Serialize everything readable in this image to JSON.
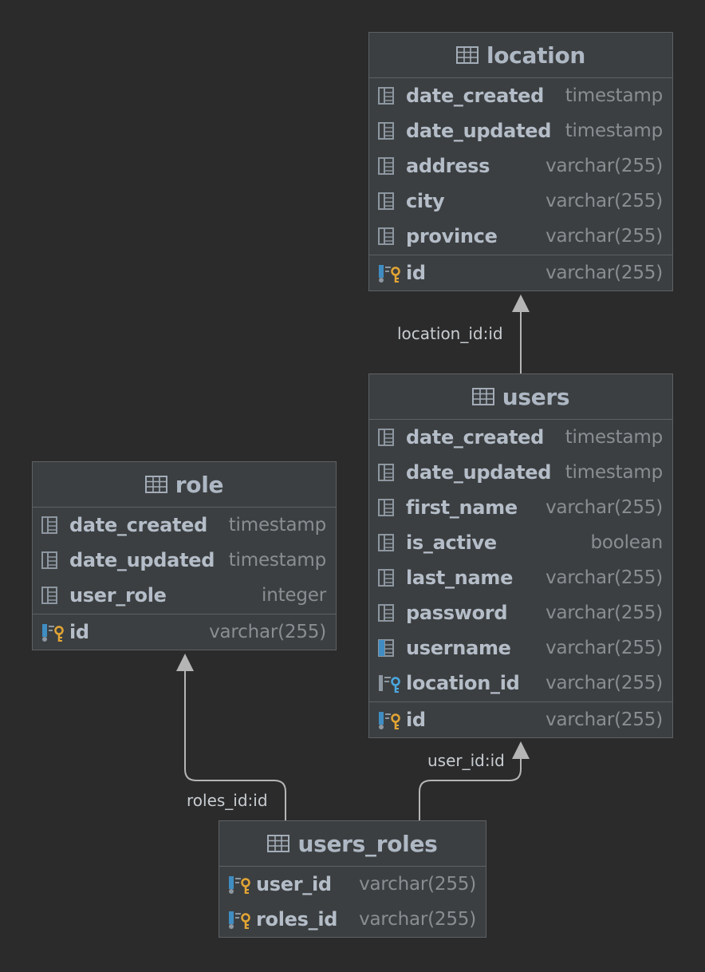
{
  "colors": {
    "background": "#2b2b2b",
    "table_bg": "#3c3f41",
    "border": "#5e6163",
    "key_gold": "#e3a534",
    "key_blue": "#4aa8e0",
    "edge": "#b5b5b5"
  },
  "tables": {
    "location": {
      "name": "location",
      "columns": [
        {
          "name": "date_created",
          "type": "timestamp",
          "icon": "column-icon"
        },
        {
          "name": "date_updated",
          "type": "timestamp",
          "icon": "column-icon"
        },
        {
          "name": "address",
          "type": "varchar(255)",
          "icon": "column-icon"
        },
        {
          "name": "city",
          "type": "varchar(255)",
          "icon": "column-icon"
        },
        {
          "name": "province",
          "type": "varchar(255)",
          "icon": "column-icon"
        }
      ],
      "pk": {
        "name": "id",
        "type": "varchar(255)",
        "icon": "primary-key-icon"
      }
    },
    "users": {
      "name": "users",
      "columns": [
        {
          "name": "date_created",
          "type": "timestamp",
          "icon": "column-icon"
        },
        {
          "name": "date_updated",
          "type": "timestamp",
          "icon": "column-icon"
        },
        {
          "name": "first_name",
          "type": "varchar(255)",
          "icon": "column-icon"
        },
        {
          "name": "is_active",
          "type": "boolean",
          "icon": "column-icon"
        },
        {
          "name": "last_name",
          "type": "varchar(255)",
          "icon": "column-icon"
        },
        {
          "name": "password",
          "type": "varchar(255)",
          "icon": "column-icon"
        },
        {
          "name": "username",
          "type": "varchar(255)",
          "icon": "unique-column-icon"
        },
        {
          "name": "location_id",
          "type": "varchar(255)",
          "icon": "foreign-key-icon"
        }
      ],
      "pk": {
        "name": "id",
        "type": "varchar(255)",
        "icon": "primary-key-icon"
      }
    },
    "role": {
      "name": "role",
      "columns": [
        {
          "name": "date_created",
          "type": "timestamp",
          "icon": "column-icon"
        },
        {
          "name": "date_updated",
          "type": "timestamp",
          "icon": "column-icon"
        },
        {
          "name": "user_role",
          "type": "integer",
          "icon": "column-icon"
        }
      ],
      "pk": {
        "name": "id",
        "type": "varchar(255)",
        "icon": "primary-key-icon"
      }
    },
    "users_roles": {
      "name": "users_roles",
      "columns": [
        {
          "name": "user_id",
          "type": "varchar(255)",
          "icon": "primary-foreign-key-icon"
        },
        {
          "name": "roles_id",
          "type": "varchar(255)",
          "icon": "primary-foreign-key-icon"
        }
      ]
    }
  },
  "edges": {
    "users_location": "location_id:id",
    "users_roles_role": "roles_id:id",
    "users_roles_users": "user_id:id"
  }
}
